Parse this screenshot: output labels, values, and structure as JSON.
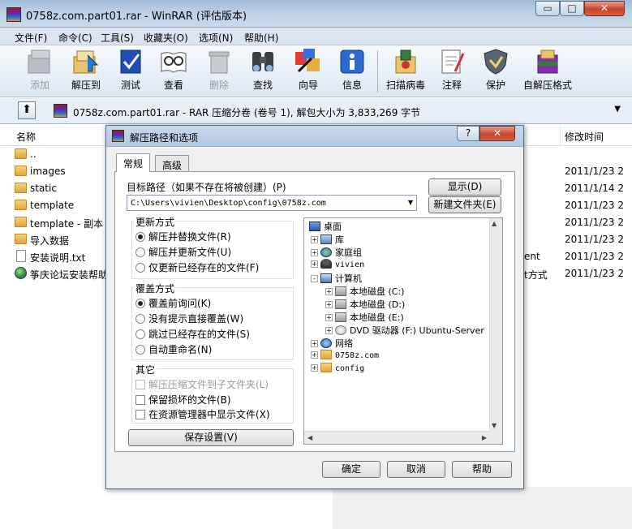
{
  "window": {
    "title": "0758z.com.part01.rar - WinRAR (评估版本)",
    "min_label": "▭",
    "max_label": "□",
    "close_label": "✕"
  },
  "menu": [
    "文件(F)",
    "命令(C)",
    "工具(S)",
    "收藏夹(O)",
    "选项(N)",
    "帮助(H)"
  ],
  "toolbar": [
    {
      "label": "添加",
      "icon": "add-archive-icon",
      "disabled": true
    },
    {
      "label": "解压到",
      "icon": "extract-to-icon",
      "disabled": false
    },
    {
      "label": "测试",
      "icon": "test-icon",
      "disabled": false
    },
    {
      "label": "查看",
      "icon": "view-icon",
      "disabled": false
    },
    {
      "label": "删除",
      "icon": "delete-icon",
      "disabled": true
    },
    {
      "label": "查找",
      "icon": "find-icon",
      "disabled": false
    },
    {
      "label": "向导",
      "icon": "wizard-icon",
      "disabled": false
    },
    {
      "label": "信息",
      "icon": "info-icon",
      "disabled": false
    },
    {
      "label": "扫描病毒",
      "icon": "virus-scan-icon",
      "disabled": false
    },
    {
      "label": "注释",
      "icon": "comment-icon",
      "disabled": false
    },
    {
      "label": "保护",
      "icon": "protect-icon",
      "disabled": false
    },
    {
      "label": "自解压格式",
      "icon": "sfx-icon",
      "disabled": false
    }
  ],
  "address": {
    "up_label": "⬆",
    "text": "0758z.com.part01.rar - RAR 压缩分卷 (卷号 1), 解包大小为 3,833,269 字节"
  },
  "list": {
    "col_name": "名称",
    "col_modified": "修改时间",
    "rows": [
      {
        "name": "..",
        "type": "folder",
        "mid": "",
        "date": ""
      },
      {
        "name": "images",
        "type": "folder",
        "mid": "",
        "date": "2011/1/23 2"
      },
      {
        "name": "static",
        "type": "folder",
        "mid": "",
        "date": "2011/1/14 2"
      },
      {
        "name": "template",
        "type": "folder",
        "mid": "",
        "date": "2011/1/23 2"
      },
      {
        "name": "template - 副本",
        "type": "folder",
        "mid": "",
        "date": "2011/1/23 2"
      },
      {
        "name": "导入数据",
        "type": "folder",
        "mid": "",
        "date": "2011/1/23 2"
      },
      {
        "name": "安装说明.txt",
        "type": "text",
        "mid": "ent",
        "date": "2011/1/23 2"
      },
      {
        "name": "筝庆论坛安装帮助",
        "type": "web",
        "mid": "t方式",
        "date": "2011/1/23 2"
      }
    ]
  },
  "dialog": {
    "title": "解压路径和选项",
    "help_label": "?",
    "close_label": "✕",
    "tabs": [
      "常规",
      "高级"
    ],
    "dest_label": "目标路径（如果不存在将被创建）(P)",
    "dest_value": "C:\\Users\\vivien\\Desktop\\config\\0758z.com",
    "show_button": "显示(D)",
    "new_folder_button": "新建文件夹(E)",
    "update_mode": {
      "title": "更新方式",
      "options": [
        "解压并替换文件(R)",
        "解压并更新文件(U)",
        "仅更新已经存在的文件(F)"
      ],
      "selected": 0
    },
    "overwrite_mode": {
      "title": "覆盖方式",
      "options": [
        "覆盖前询问(K)",
        "没有提示直接覆盖(W)",
        "跳过已经存在的文件(S)",
        "自动重命名(N)"
      ],
      "selected": 0
    },
    "misc": {
      "title": "其它",
      "options": [
        {
          "label": "解压压缩文件到子文件夹(L)",
          "disabled": true
        },
        {
          "label": "保留损坏的文件(B)",
          "disabled": false
        },
        {
          "label": "在资源管理器中显示文件(X)",
          "disabled": false
        }
      ]
    },
    "save_button": "保存设置(V)",
    "tree": [
      {
        "label": "桌面",
        "level": 0,
        "exp": "",
        "mono": false
      },
      {
        "label": "库",
        "level": 1,
        "exp": "+",
        "mono": false
      },
      {
        "label": "家庭组",
        "level": 1,
        "exp": "+",
        "mono": false
      },
      {
        "label": "vivien",
        "level": 1,
        "exp": "+",
        "mono": true
      },
      {
        "label": "计算机",
        "level": 1,
        "exp": "-",
        "mono": false
      },
      {
        "label": "本地磁盘 (C:)",
        "level": 2,
        "exp": "+",
        "mono": false
      },
      {
        "label": "本地磁盘 (D:)",
        "level": 2,
        "exp": "+",
        "mono": false
      },
      {
        "label": "本地磁盘 (E:)",
        "level": 2,
        "exp": "+",
        "mono": false
      },
      {
        "label": "DVD 驱动器 (F:) Ubuntu-Server",
        "level": 2,
        "exp": "+",
        "mono": false
      },
      {
        "label": "网络",
        "level": 1,
        "exp": "+",
        "mono": false
      },
      {
        "label": "0758z.com",
        "level": 1,
        "exp": "+",
        "mono": true
      },
      {
        "label": "config",
        "level": 1,
        "exp": "+",
        "mono": true
      }
    ],
    "ok_button": "确定",
    "cancel_button": "取消",
    "help_button": "帮助"
  }
}
